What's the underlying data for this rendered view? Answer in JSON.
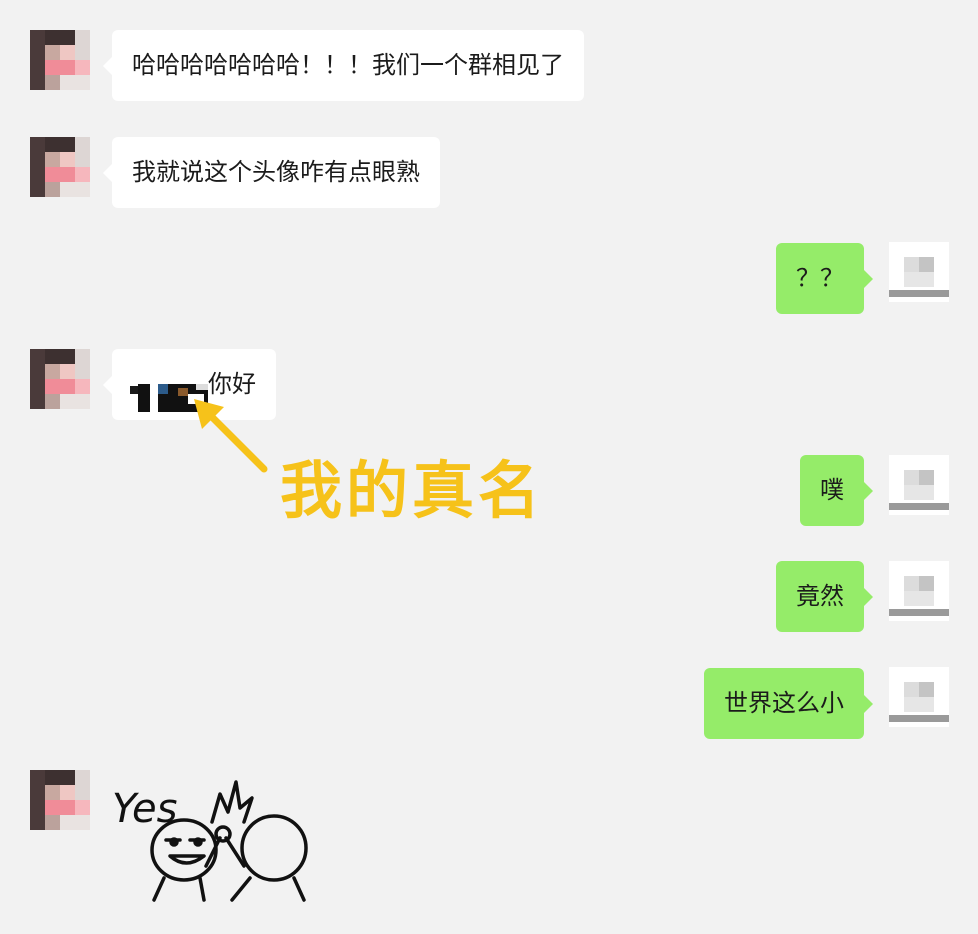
{
  "messages": [
    {
      "side": "in",
      "text": "哈哈哈哈哈哈哈！！！我们一个群相见了"
    },
    {
      "side": "in",
      "text": "我就说这个头像咋有点眼熟"
    },
    {
      "side": "out",
      "text": "？？"
    },
    {
      "side": "in",
      "text": "你好"
    },
    {
      "side": "out",
      "text": "噗"
    },
    {
      "side": "out",
      "text": "竟然"
    },
    {
      "side": "out",
      "text": "世界这么小"
    }
  ],
  "annotation": {
    "text": "我的真名",
    "color": "#f6c21a"
  },
  "sticker": {
    "text": "Yes",
    "icon": "high-five-sticker"
  },
  "colors": {
    "background": "#f2f2f2",
    "bubble_in": "#ffffff",
    "bubble_out": "#95ec69"
  }
}
